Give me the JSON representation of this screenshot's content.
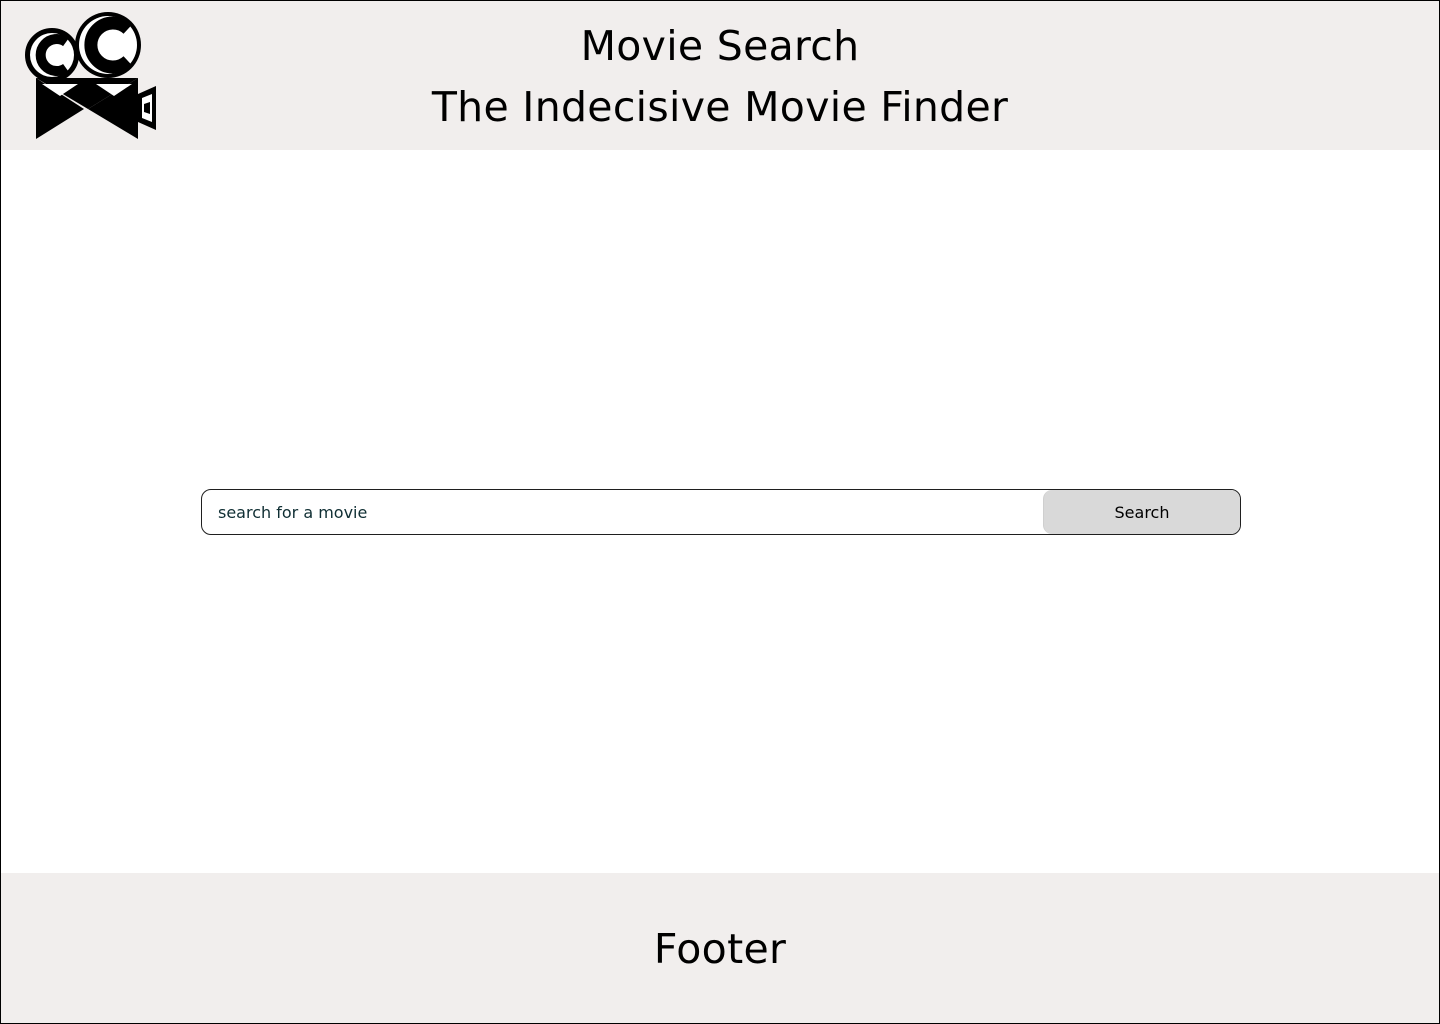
{
  "header": {
    "logo_icon": "film-camera-logo-icon",
    "title": "Movie Search",
    "subtitle": "The Indecisive Movie Finder"
  },
  "search": {
    "placeholder": "search for a movie",
    "value": "",
    "button_label": "Search"
  },
  "footer": {
    "text": "Footer"
  },
  "colors": {
    "band_background": "#f1eeed",
    "page_background": "#ffffff",
    "button_background": "#d9d9d9",
    "placeholder_text": "#0f2e33"
  }
}
